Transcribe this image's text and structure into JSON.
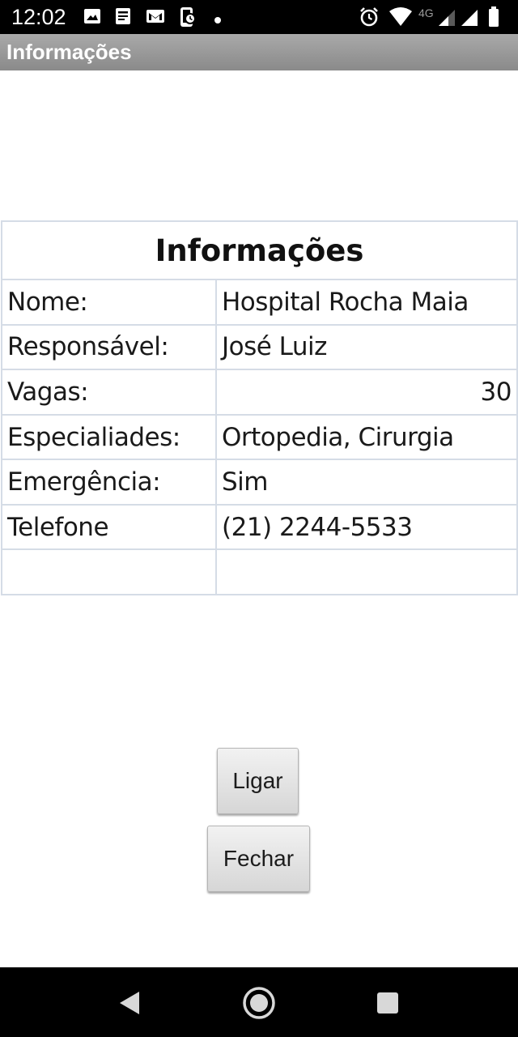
{
  "status_bar": {
    "time": "12:02",
    "network_label": "4G",
    "icons": [
      "image-icon",
      "news-icon",
      "gmail-icon",
      "phone-app-icon",
      "dot-icon",
      "alarm-icon",
      "wifi-icon",
      "signal-icon",
      "signal-icon",
      "battery-icon"
    ]
  },
  "app": {
    "title": "Informações"
  },
  "info": {
    "header": "Informações",
    "rows": [
      {
        "label": "Nome:",
        "value": "Hospital Rocha Maia"
      },
      {
        "label": "Responsável:",
        "value": "José Luiz"
      },
      {
        "label": "Vagas:",
        "value": "30"
      },
      {
        "label": "Especialiades:",
        "value": "Ortopedia, Cirurgia"
      },
      {
        "label": "Emergência:",
        "value": "Sim"
      },
      {
        "label": "Telefone",
        "value": "(21) 2244-5533"
      },
      {
        "label": "",
        "value": ""
      }
    ]
  },
  "buttons": {
    "call_label": "Ligar",
    "close_label": "Fechar"
  },
  "nav_bar": {
    "icons": [
      "back-icon",
      "home-icon",
      "recents-icon"
    ]
  }
}
